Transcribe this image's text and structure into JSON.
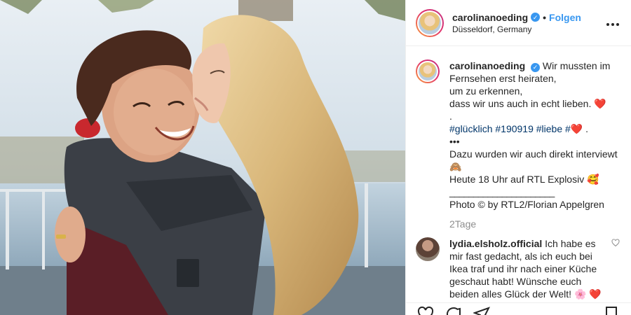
{
  "post": {
    "username": "carolinanoeding",
    "verified_mark": "✓",
    "dot": "•",
    "follow_label": "Folgen",
    "location": "Düsseldorf, Germany",
    "more_icon": "more-horizontal-icon"
  },
  "caption": {
    "username": "carolinanoeding",
    "lines": [
      "Wir mussten im",
      "Fernsehen erst heiraten,",
      "um zu erkennen,",
      "dass wir uns auch in echt lieben.",
      ".",
      "#glücklich #190919 #liebe #",
      "•••",
      "Dazu wurden wir auch direkt interviewt",
      "🙈",
      "Heute 18 Uhr auf RTL Explosiv",
      "______________________",
      "Photo © by RTL2/Florian Appelgren"
    ],
    "heart_emoji": "❤️",
    "monkey_emoji": "🙈",
    "smile_emoji": "🥰",
    "period": " ."
  },
  "time_ago": "2Tage",
  "comment": {
    "username": "lydia.elsholz.official",
    "text": "Ich habe es mir fast gedacht, als ich euch bei Ikea traf und ihr nach einer Küche geschaut habt! Wünsche euch beiden alles Glück der Welt!",
    "emojis": "🌸 ❤️",
    "like_icon": "heart-outline-icon"
  },
  "actions": {
    "icons": [
      "heart-icon",
      "comment-icon",
      "share-icon",
      "bookmark-icon"
    ]
  },
  "colors": {
    "link_blue": "#3897f0",
    "hashtag": "#003569",
    "muted": "#8e8e8e",
    "heart": "#e0245e"
  }
}
